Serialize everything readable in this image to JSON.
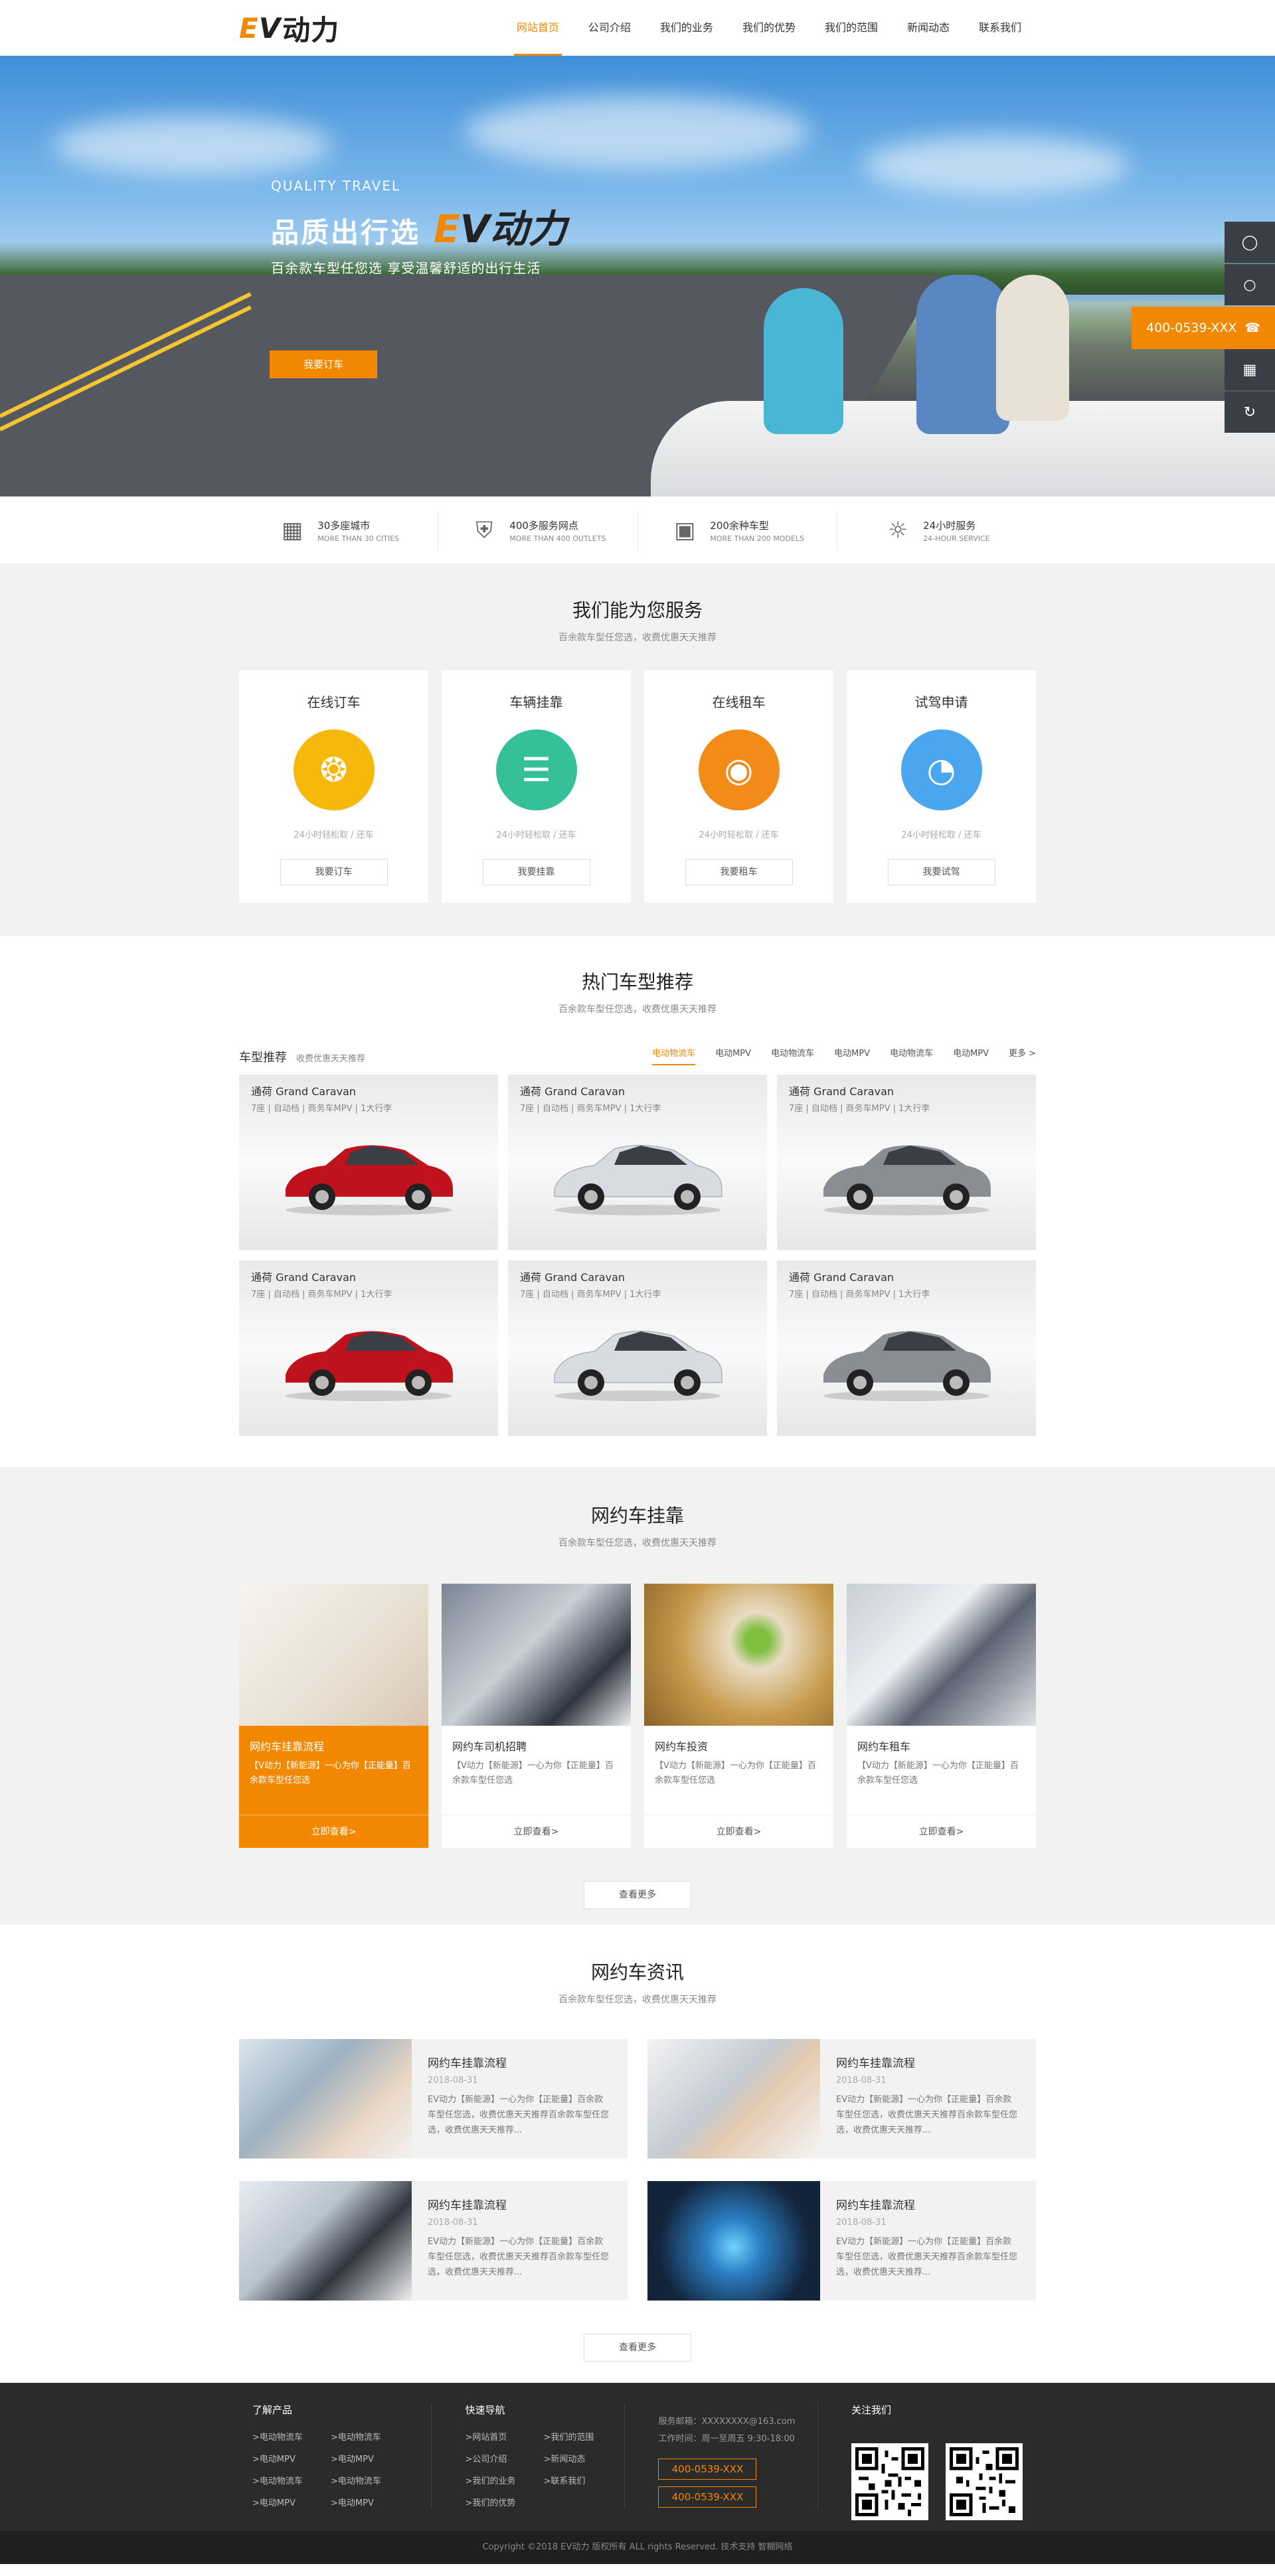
{
  "header": {
    "logo_e": "E",
    "logo_v": "V",
    "logo_cn": "动力",
    "nav": [
      "网站首页",
      "公司介绍",
      "我们的业务",
      "我们的优势",
      "我们的范围",
      "新闻动态",
      "联系我们"
    ]
  },
  "banner": {
    "tag": "QUALITY TRAVEL",
    "headline": "品质出行选",
    "brand_e": "E",
    "brand_v": "V",
    "brand_cn": "动力",
    "sub": "百余款车型任您选 享受温馨舒适的出行生活",
    "button": "我要订车",
    "dots": 4
  },
  "side": {
    "phone": "400-0539-XXX"
  },
  "features": [
    {
      "icon": "city-icon",
      "t1": "30多座城市",
      "t2": "MORE THAN 30 CITIES"
    },
    {
      "icon": "shield-icon",
      "t1": "400多服务网点",
      "t2": "MORE THAN 400 OUTLETS"
    },
    {
      "icon": "car-icon",
      "t1": "200余种车型",
      "t2": "MORE THAN 200 MODELS"
    },
    {
      "icon": "sun-icon",
      "t1": "24小时服务",
      "t2": "24-HOUR SERVICE"
    }
  ],
  "services": {
    "title": "我们能为您服务",
    "sub": "百余款车型任您选，收费优惠天天推荐",
    "cards": [
      {
        "title": "在线订车",
        "desc": "24小时轻松取 / 还车",
        "btn": "我要订车",
        "color": "#f5b80b",
        "icon": "steering-wheel-icon"
      },
      {
        "title": "车辆挂靠",
        "desc": "24小时轻松取 / 还车",
        "btn": "我要挂靠",
        "color": "#35c09a",
        "icon": "clipboard-icon"
      },
      {
        "title": "在线租车",
        "desc": "24小时轻松取 / 还车",
        "btn": "我要租车",
        "color": "#f28b17",
        "icon": "car-front-icon"
      },
      {
        "title": "试驾申请",
        "desc": "24小时轻松取 / 还车",
        "btn": "我要试驾",
        "color": "#4aa6ef",
        "icon": "speedometer-icon"
      }
    ]
  },
  "models": {
    "title": "热门车型推荐",
    "sub": "百余款车型任您选，收费优惠天天推荐",
    "label": "车型推荐",
    "label_sub": "收费优惠天天推荐",
    "tabs": [
      "电动物流车",
      "电动MPV",
      "电动物流车",
      "电动MPV",
      "电动物流车",
      "电动MPV",
      "更多 >"
    ],
    "cars": [
      {
        "name": "通荷 Grand Caravan",
        "spec": "7座 | 自动档 | 商务车MPV | 1大行李",
        "color": "#c0121c"
      },
      {
        "name": "通荷 Grand Caravan",
        "spec": "7座 | 自动档 | 商务车MPV | 1大行李",
        "color": "#d8dbdf"
      },
      {
        "name": "通荷 Grand Caravan",
        "spec": "7座 | 自动档 | 商务车MPV | 1大行李",
        "color": "#8a8d92"
      },
      {
        "name": "通荷 Grand Caravan",
        "spec": "7座 | 自动档 | 商务车MPV | 1大行李",
        "color": "#c0121c"
      },
      {
        "name": "通荷 Grand Caravan",
        "spec": "7座 | 自动档 | 商务车MPV | 1大行李",
        "color": "#d8dbdf"
      },
      {
        "name": "通荷 Grand Caravan",
        "spec": "7座 | 自动档 | 商务车MPV | 1大行李",
        "color": "#8a8d92"
      }
    ]
  },
  "hail": {
    "title": "网约车挂靠",
    "sub": "百余款车型任您选，收费优惠天天推荐",
    "cards": [
      {
        "title": "网约车挂靠流程",
        "desc": "【V动力【新能源】一心为你【正能量】百余款车型任您选",
        "more": "立即查看>"
      },
      {
        "title": "网约车司机招聘",
        "desc": "【V动力【新能源】一心为你【正能量】百余款车型任您选",
        "more": "立即查看>"
      },
      {
        "title": "网约车投资",
        "desc": "【V动力【新能源】一心为你【正能量】百余款车型任您选",
        "more": "立即查看>"
      },
      {
        "title": "网约车租车",
        "desc": "【V动力【新能源】一心为你【正能量】百余款车型任您选",
        "more": "立即查看>"
      }
    ],
    "more": "查看更多"
  },
  "news": {
    "title": "网约车资讯",
    "sub": "百余款车型任您选，收费优惠天天推荐",
    "items": [
      {
        "title": "网约车挂靠流程",
        "date": "2018-08-31",
        "desc": "EV动力【新能源】一心为你【正能量】百余款车型任您选，收费优惠天天推荐百余款车型任您选，收费优惠天天推荐..."
      },
      {
        "title": "网约车挂靠流程",
        "date": "2018-08-31",
        "desc": "EV动力【新能源】一心为你【正能量】百余款车型任您选，收费优惠天天推荐百余款车型任您选，收费优惠天天推荐..."
      },
      {
        "title": "网约车挂靠流程",
        "date": "2018-08-31",
        "desc": "EV动力【新能源】一心为你【正能量】百余款车型任您选，收费优惠天天推荐百余款车型任您选，收费优惠天天推荐..."
      },
      {
        "title": "网约车挂靠流程",
        "date": "2018-08-31",
        "desc": "EV动力【新能源】一心为你【正能量】百余款车型任您选，收费优惠天天推荐百余款车型任您选，收费优惠天天推荐..."
      }
    ],
    "more": "查看更多"
  },
  "footer": {
    "col1_title": "了解产品",
    "col1": [
      ">电动物流车",
      ">电动物流车",
      ">电动MPV",
      ">电动MPV",
      ">电动物流车",
      ">电动物流车",
      ">电动MPV",
      ">电动MPV"
    ],
    "col2_title": "快速导航",
    "col2": [
      ">网站首页",
      ">我们的范围",
      ">公司介绍",
      ">新闻动态",
      ">我们的业务",
      ">联系我们",
      ">我们的优势"
    ],
    "email": "服务邮箱：XXXXXXXX@163.com",
    "hours": "工作时间：周一至周五 9:30-18:00",
    "phone1": "400-0539-XXX",
    "phone2": "400-0539-XXX",
    "follow": "关注我们",
    "copyright": "Copyright ©2018 EV动力  版权所有 ALL rights Reserved. 技术支持 智糊网络"
  }
}
